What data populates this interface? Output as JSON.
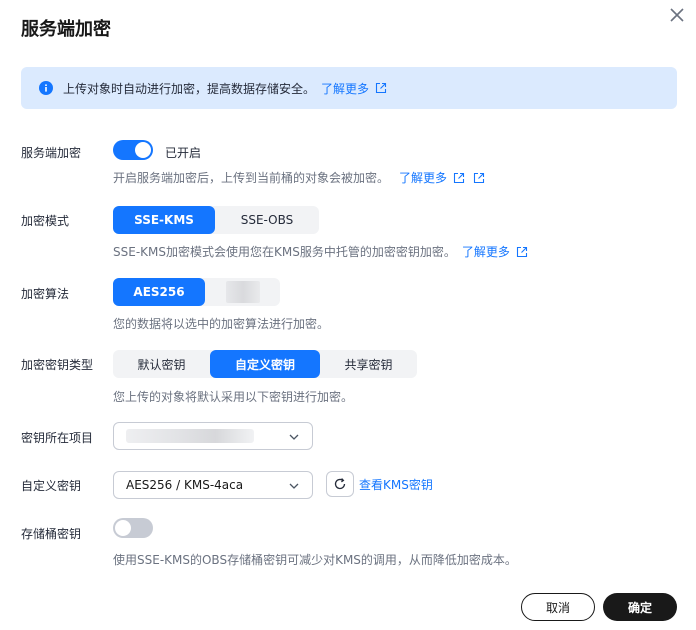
{
  "dialog": {
    "title": "服务端加密"
  },
  "notice": {
    "text": "上传对象时自动进行加密，提高数据存储安全。",
    "link": "了解更多"
  },
  "encryption": {
    "label": "服务端加密",
    "state": "已开启",
    "enabled": true,
    "hint": "开启服务端加密后，上传到当前桶的对象会被加密。",
    "link": "了解更多"
  },
  "mode": {
    "label": "加密模式",
    "options": [
      "SSE-KMS",
      "SSE-OBS"
    ],
    "selected": "SSE-KMS",
    "hint": "SSE-KMS加密模式会使用您在KMS服务中托管的加密密钥加密。",
    "link": "了解更多"
  },
  "algorithm": {
    "label": "加密算法",
    "options": [
      "AES256"
    ],
    "selected": "AES256",
    "hint": "您的数据将以选中的加密算法进行加密。"
  },
  "key_type": {
    "label": "加密密钥类型",
    "options": [
      "默认密钥",
      "自定义密钥",
      "共享密钥"
    ],
    "selected": "自定义密钥",
    "hint": "您上传的对象将默认采用以下密钥进行加密。"
  },
  "project": {
    "label": "密钥所在项目"
  },
  "custom_key": {
    "label": "自定义密钥",
    "value": "AES256 / KMS-4aca",
    "view_link": "查看KMS密钥"
  },
  "bucket_key": {
    "label": "存储桶密钥",
    "enabled": false,
    "hint": "使用SSE-KMS的OBS存储桶密钥可减少对KMS的调用，从而降低加密成本。"
  },
  "footer": {
    "cancel": "取消",
    "ok": "确定"
  },
  "colors": {
    "accent": "#1476ff",
    "notice_bg": "#dbeafe",
    "primary_button": "#191919"
  }
}
